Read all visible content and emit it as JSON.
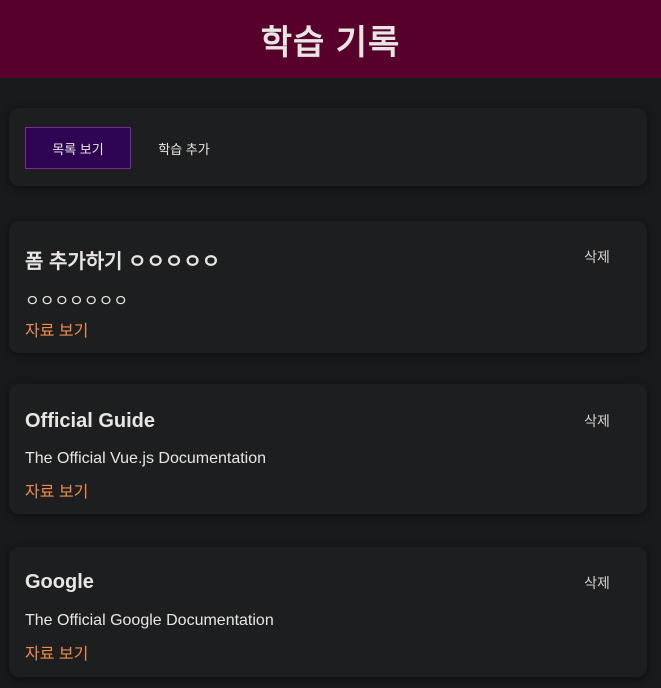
{
  "header": {
    "title": "학습 기록"
  },
  "tabs": {
    "list_label": "목록 보기",
    "add_label": "학습 추가"
  },
  "resources": [
    {
      "title": "폼 추가하기 ㅇㅇㅇㅇㅇ",
      "description": "ㅇㅇㅇㅇㅇㅇㅇ",
      "link_label": "자료 보기",
      "delete_label": "삭제"
    },
    {
      "title": "Official Guide",
      "description": "The Official Vue.js Documentation",
      "link_label": "자료 보기",
      "delete_label": "삭제"
    },
    {
      "title": "Google",
      "description": "The Official Google Documentation",
      "link_label": "자료 보기",
      "delete_label": "삭제"
    }
  ],
  "colors": {
    "header_bg": "#58002c",
    "page_bg": "#181a1b",
    "active_tab_bg": "#2e0552",
    "link": "#f08b4b"
  }
}
